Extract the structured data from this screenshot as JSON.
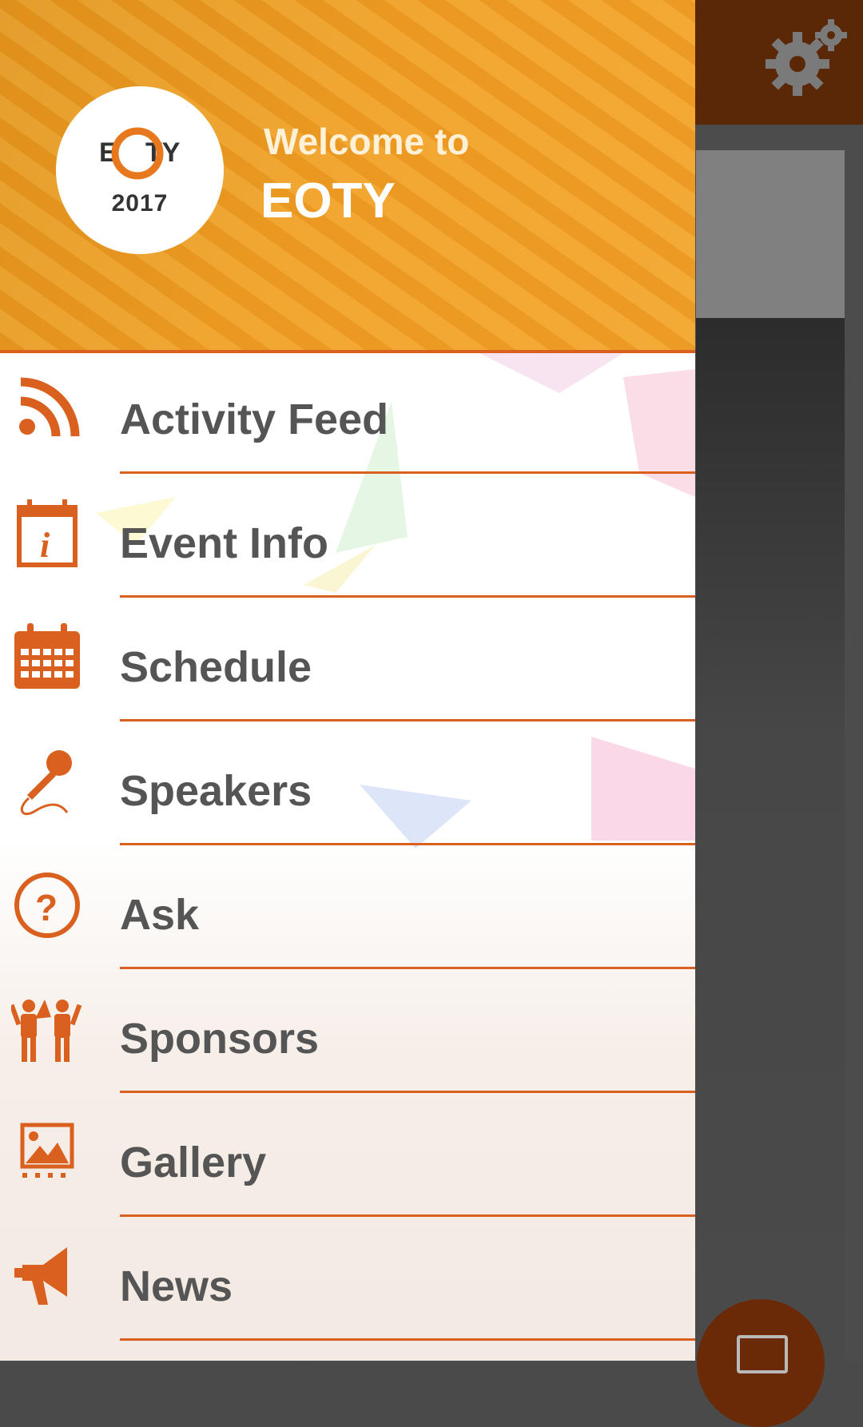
{
  "header": {
    "welcome_text": "Welcome to",
    "app_name": "EOTY",
    "logo": {
      "mark_text": "EOTY",
      "year": "2017"
    }
  },
  "menu": {
    "items": [
      {
        "label": "Activity Feed",
        "icon": "rss-icon"
      },
      {
        "label": "Event Info",
        "icon": "event-info-icon"
      },
      {
        "label": "Schedule",
        "icon": "calendar-icon"
      },
      {
        "label": "Speakers",
        "icon": "microphone-icon"
      },
      {
        "label": "Ask",
        "icon": "question-icon"
      },
      {
        "label": "Sponsors",
        "icon": "people-icon"
      },
      {
        "label": "Gallery",
        "icon": "gallery-icon"
      },
      {
        "label": "News",
        "icon": "megaphone-icon"
      }
    ]
  },
  "colors": {
    "accent": "#d9601e",
    "header_orange": "#f2a226",
    "topbar_brown": "#5b2807",
    "menu_text": "#555555"
  }
}
